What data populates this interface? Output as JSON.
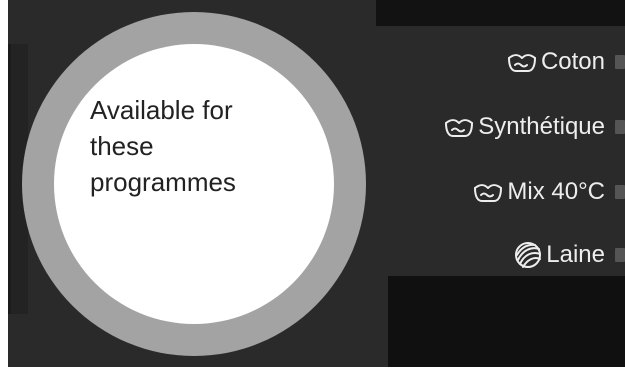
{
  "availability": {
    "lines": [
      "Available for",
      "these",
      "programmes"
    ]
  },
  "programmes": [
    {
      "label": "Coton",
      "icon": "washing-tub-icon"
    },
    {
      "label": "Synthétique",
      "icon": "washing-tub-icon"
    },
    {
      "label": "Mix 40°C",
      "icon": "washing-tub-icon"
    },
    {
      "label": "Laine",
      "icon": "wool-ball-icon"
    }
  ],
  "colors": {
    "panel": "#2a2a2a",
    "ring": "#a3a3a3",
    "disc": "#ffffff",
    "label_text": "#ededed",
    "disc_text": "#222222"
  }
}
